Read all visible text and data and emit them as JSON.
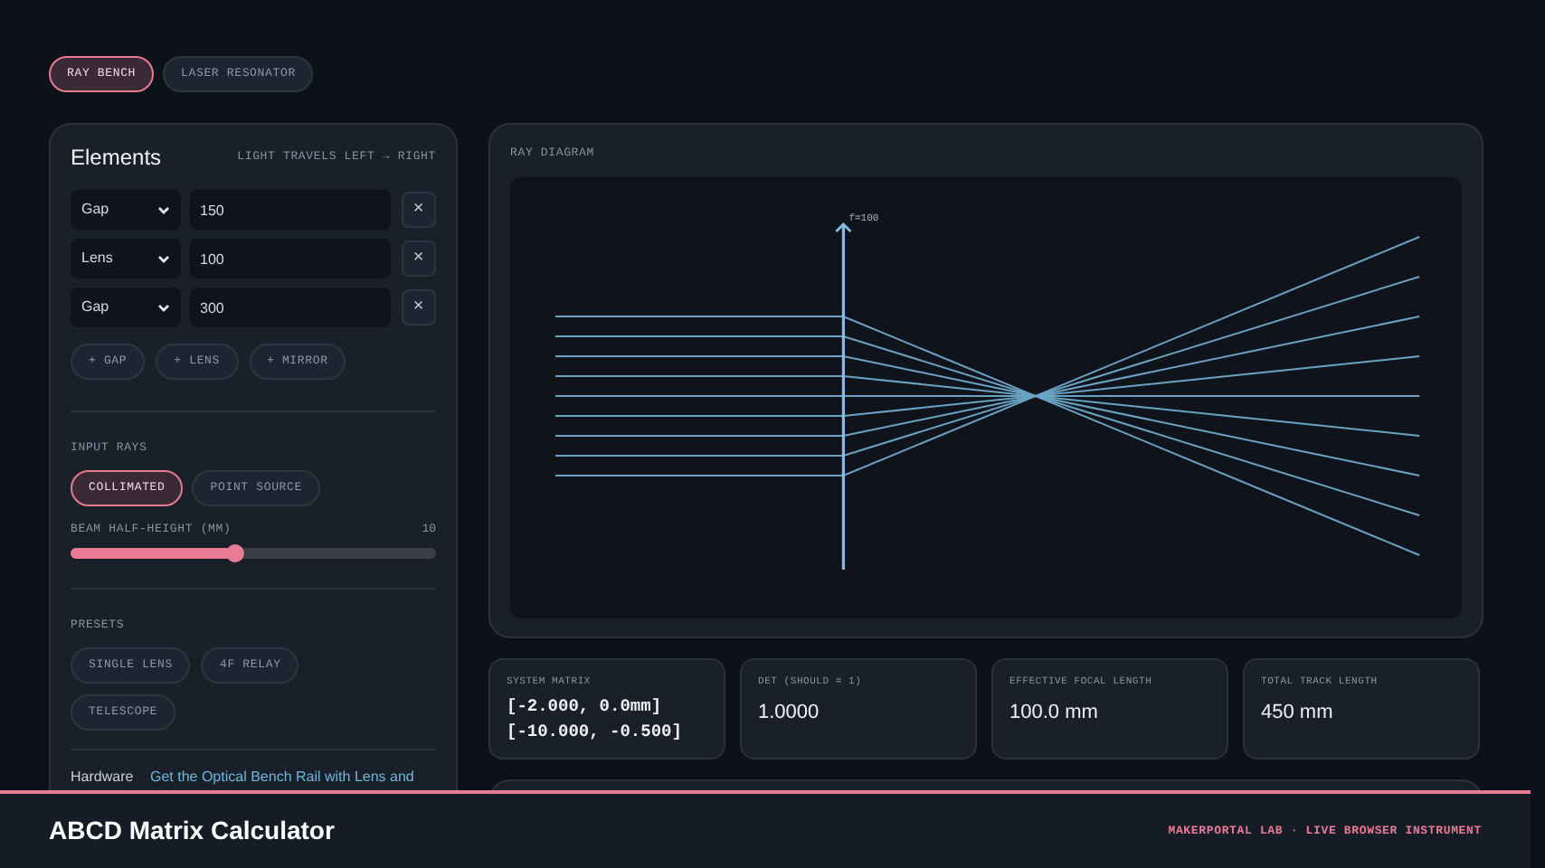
{
  "tabs": [
    {
      "label": "RAY BENCH",
      "selected": true
    },
    {
      "label": "LASER RESONATOR",
      "selected": false
    }
  ],
  "elements_panel": {
    "title": "Elements",
    "hint": "LIGHT TRAVELS LEFT → RIGHT",
    "rows": [
      {
        "kind": "gap",
        "type_label": "Gap",
        "value": "150",
        "remove": "×"
      },
      {
        "kind": "lens",
        "type_label": "Lens",
        "value": "100",
        "remove": "×"
      },
      {
        "kind": "gap",
        "type_label": "Gap",
        "value": "300",
        "remove": "×"
      }
    ],
    "add_buttons": [
      "+ GAP",
      "+ LENS",
      "+ MIRROR"
    ]
  },
  "input_rays": {
    "heading": "INPUT RAYS",
    "modes": [
      {
        "label": "COLLIMATED",
        "selected": true
      },
      {
        "label": "POINT SOURCE",
        "selected": false
      }
    ],
    "slider": {
      "label": "BEAM HALF-HEIGHT (MM)",
      "reading": "10",
      "level": 0.45
    }
  },
  "presets": {
    "heading": "PRESETS",
    "buttons": [
      "SINGLE LENS",
      "4F RELAY",
      "TELESCOPE"
    ]
  },
  "hardware": {
    "label": "Hardware",
    "link": "Get the Optical Bench Rail with Lens and"
  },
  "ray_diagram": {
    "title": "RAY DIAGRAM",
    "lens_label": "f=100"
  },
  "stats": [
    {
      "kind": "matrix",
      "label": "SYSTEM MATRIX",
      "lines": [
        "[-2.000, 0.0mm]",
        "[-10.000, -0.500]"
      ]
    },
    {
      "kind": "value",
      "label": "DET (SHOULD = 1)",
      "value": "1.0000"
    },
    {
      "kind": "value",
      "label": "EFFECTIVE FOCAL LENGTH",
      "value": "100.0 mm"
    },
    {
      "kind": "value",
      "label": "TOTAL TRACK LENGTH",
      "value": "450 mm"
    }
  ],
  "footer": {
    "title": "ABCD Matrix Calculator",
    "tagline": "MAKERPORTAL LAB · LIVE BROWSER INSTRUMENT"
  }
}
